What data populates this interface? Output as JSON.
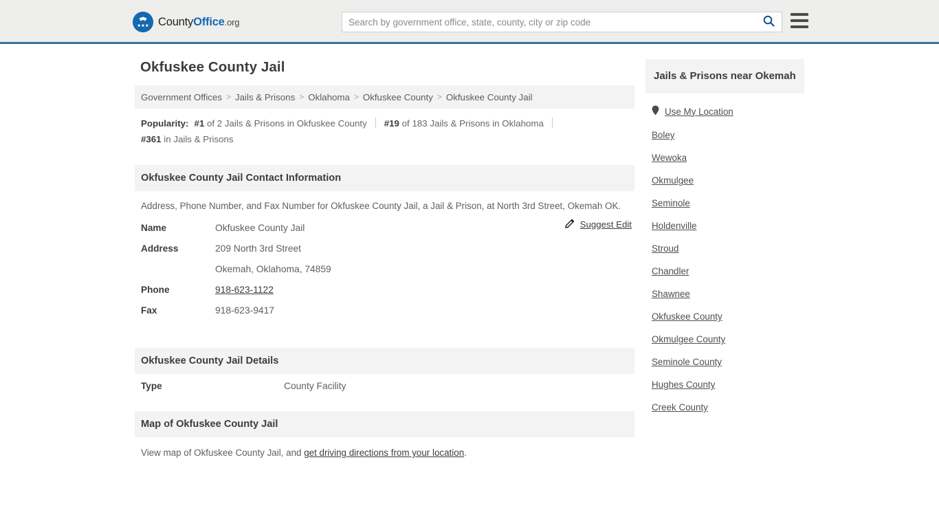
{
  "header": {
    "logo": {
      "part1": "County",
      "part2": "Office",
      "part3": ".org",
      "icon": "eagle-stars-logo-icon"
    },
    "search": {
      "placeholder": "Search by government office, state, county, city or zip code",
      "value": "",
      "icon": "search-icon"
    },
    "menu_icon": "hamburger-menu-icon",
    "accent_color": "#36729f"
  },
  "page_title": "Okfuskee County Jail",
  "breadcrumb": {
    "separator": ">",
    "items": [
      "Government Offices",
      "Jails & Prisons",
      "Oklahoma",
      "Okfuskee County",
      "Okfuskee County Jail"
    ]
  },
  "popularity": {
    "label": "Popularity:",
    "items": [
      {
        "rank": "#1",
        "text": "of 2 Jails & Prisons in Okfuskee County"
      },
      {
        "rank": "#19",
        "text": "of 183 Jails & Prisons in Oklahoma"
      },
      {
        "rank": "#361",
        "text": "in Jails & Prisons"
      }
    ]
  },
  "contact_section": {
    "heading": "Okfuskee County Jail Contact Information",
    "description": "Address, Phone Number, and Fax Number for Okfuskee County Jail, a Jail & Prison, at North 3rd Street, Okemah OK.",
    "suggest_edit": {
      "label": "Suggest Edit",
      "icon": "edit-pencil-icon"
    },
    "rows": [
      {
        "label": "Name",
        "value": "Okfuskee County Jail",
        "link": false
      },
      {
        "label": "Address",
        "value": "209 North 3rd Street",
        "link": false
      },
      {
        "label": "",
        "value": "Okemah, Oklahoma, 74859",
        "link": false
      },
      {
        "label": "Phone",
        "value": "918-623-1122",
        "link": true
      },
      {
        "label": "Fax",
        "value": "918-623-9417",
        "link": false
      }
    ]
  },
  "details_section": {
    "heading": "Okfuskee County Jail Details",
    "rows": [
      {
        "label": "Type",
        "value": "County Facility"
      }
    ]
  },
  "map_section": {
    "heading": "Map of Okfuskee County Jail",
    "note_prefix": "View map of Okfuskee County Jail, and ",
    "note_link": "get driving directions from your location",
    "note_suffix": "."
  },
  "sidebar": {
    "heading": "Jails & Prisons near Okemah",
    "use_my_location": {
      "label": "Use My Location",
      "icon": "map-pin-icon"
    },
    "items": [
      "Boley",
      "Wewoka",
      "Okmulgee",
      "Seminole",
      "Holdenville",
      "Stroud",
      "Chandler",
      "Shawnee",
      "Okfuskee County",
      "Okmulgee County",
      "Seminole County",
      "Hughes County",
      "Creek County"
    ]
  }
}
